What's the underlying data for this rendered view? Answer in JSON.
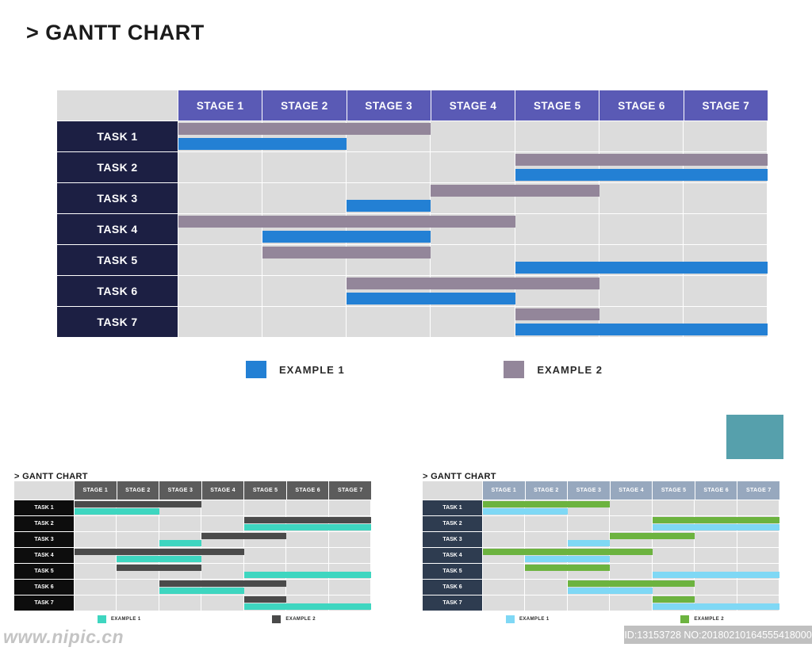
{
  "page": {
    "title": "> GANTT CHART"
  },
  "colors": {
    "header_purple": "#5a5ab5",
    "task_navy": "#1c1f43",
    "cell_gray": "#dcdcdc",
    "series1_blue": "#2380d4",
    "series2_mauve": "#93869a",
    "teal_block": "#56a0ac",
    "thumb_left_header": "#5c5c5c",
    "thumb_left_task": "#0d0d0d",
    "thumb_left_series1": "#3ed6c0",
    "thumb_left_series2": "#4a4a4a",
    "thumb_right_header": "#97a8be",
    "thumb_right_task": "#2e3c50",
    "thumb_right_series1": "#7fd8f5",
    "thumb_right_series2": "#6cb33f"
  },
  "chart_data": {
    "type": "bar",
    "title": "> GANTT CHART",
    "xlabel": "",
    "ylabel": "",
    "grid": true,
    "legend_position": "bottom",
    "categories": [
      "STAGE 1",
      "STAGE 2",
      "STAGE 3",
      "STAGE 4",
      "STAGE 5",
      "STAGE 6",
      "STAGE 7"
    ],
    "tasks": [
      "TASK 1",
      "TASK 2",
      "TASK 3",
      "TASK 4",
      "TASK 5",
      "TASK 6",
      "TASK 7"
    ],
    "legend": [
      {
        "label": "EXAMPLE 1",
        "color": "#2380d4"
      },
      {
        "label": "EXAMPLE 2",
        "color": "#93869a"
      }
    ],
    "series": [
      {
        "name": "EXAMPLE 2",
        "color": "#93869a",
        "row": "top",
        "bars": [
          {
            "task": "TASK 1",
            "start": 0,
            "end": 3
          },
          {
            "task": "TASK 2",
            "start": 4,
            "end": 7
          },
          {
            "task": "TASK 3",
            "start": 3,
            "end": 5
          },
          {
            "task": "TASK 4",
            "start": 0,
            "end": 4
          },
          {
            "task": "TASK 5",
            "start": 1,
            "end": 3
          },
          {
            "task": "TASK 6",
            "start": 2,
            "end": 5
          },
          {
            "task": "TASK 7",
            "start": 4,
            "end": 5
          }
        ]
      },
      {
        "name": "EXAMPLE 1",
        "color": "#2380d4",
        "row": "bottom",
        "bars": [
          {
            "task": "TASK 1",
            "start": 0,
            "end": 2
          },
          {
            "task": "TASK 2",
            "start": 4,
            "end": 7
          },
          {
            "task": "TASK 3",
            "start": 2,
            "end": 3
          },
          {
            "task": "TASK 4",
            "start": 1,
            "end": 3
          },
          {
            "task": "TASK 5",
            "start": 4,
            "end": 7
          },
          {
            "task": "TASK 6",
            "start": 2,
            "end": 4
          },
          {
            "task": "TASK 7",
            "start": 4,
            "end": 7
          }
        ]
      }
    ]
  },
  "thumbnails": [
    {
      "id": "thumb-left",
      "title": "> GANTT CHART",
      "header_bg": "#5c5c5c",
      "task_bg": "#0d0d0d",
      "legend": [
        {
          "label": "EXAMPLE 1",
          "color": "#3ed6c0"
        },
        {
          "label": "EXAMPLE 2",
          "color": "#4a4a4a"
        }
      ],
      "categories": [
        "STAGE 1",
        "STAGE 2",
        "STAGE 3",
        "STAGE 4",
        "STAGE 5",
        "STAGE 6",
        "STAGE 7"
      ],
      "tasks": [
        "TASK 1",
        "TASK 2",
        "TASK 3",
        "TASK 4",
        "TASK 5",
        "TASK 6",
        "TASK 7"
      ],
      "series": [
        {
          "name": "EXAMPLE 2",
          "color": "#4a4a4a",
          "row": "top",
          "bars": [
            {
              "task": "TASK 1",
              "start": 0,
              "end": 3
            },
            {
              "task": "TASK 2",
              "start": 4,
              "end": 7
            },
            {
              "task": "TASK 3",
              "start": 3,
              "end": 5
            },
            {
              "task": "TASK 4",
              "start": 0,
              "end": 4
            },
            {
              "task": "TASK 5",
              "start": 1,
              "end": 3
            },
            {
              "task": "TASK 6",
              "start": 2,
              "end": 5
            },
            {
              "task": "TASK 7",
              "start": 4,
              "end": 5
            }
          ]
        },
        {
          "name": "EXAMPLE 1",
          "color": "#3ed6c0",
          "row": "bottom",
          "bars": [
            {
              "task": "TASK 1",
              "start": 0,
              "end": 2
            },
            {
              "task": "TASK 2",
              "start": 4,
              "end": 7
            },
            {
              "task": "TASK 3",
              "start": 2,
              "end": 3
            },
            {
              "task": "TASK 4",
              "start": 1,
              "end": 3
            },
            {
              "task": "TASK 5",
              "start": 4,
              "end": 7
            },
            {
              "task": "TASK 6",
              "start": 2,
              "end": 4
            },
            {
              "task": "TASK 7",
              "start": 4,
              "end": 7
            }
          ]
        }
      ]
    },
    {
      "id": "thumb-right",
      "title": "> GANTT CHART",
      "header_bg": "#97a8be",
      "task_bg": "#2e3c50",
      "legend": [
        {
          "label": "EXAMPLE 1",
          "color": "#7fd8f5"
        },
        {
          "label": "EXAMPLE 2",
          "color": "#6cb33f"
        }
      ],
      "categories": [
        "STAGE 1",
        "STAGE 2",
        "STAGE 3",
        "STAGE 4",
        "STAGE 5",
        "STAGE 6",
        "STAGE 7"
      ],
      "tasks": [
        "TASK 1",
        "TASK 2",
        "TASK 3",
        "TASK 4",
        "TASK 5",
        "TASK 6",
        "TASK 7"
      ],
      "series": [
        {
          "name": "EXAMPLE 2",
          "color": "#6cb33f",
          "row": "top",
          "bars": [
            {
              "task": "TASK 1",
              "start": 0,
              "end": 3
            },
            {
              "task": "TASK 2",
              "start": 4,
              "end": 7
            },
            {
              "task": "TASK 3",
              "start": 3,
              "end": 5
            },
            {
              "task": "TASK 4",
              "start": 0,
              "end": 4
            },
            {
              "task": "TASK 5",
              "start": 1,
              "end": 3
            },
            {
              "task": "TASK 6",
              "start": 2,
              "end": 5
            },
            {
              "task": "TASK 7",
              "start": 4,
              "end": 5
            }
          ]
        },
        {
          "name": "EXAMPLE 1",
          "color": "#7fd8f5",
          "row": "bottom",
          "bars": [
            {
              "task": "TASK 1",
              "start": 0,
              "end": 2
            },
            {
              "task": "TASK 2",
              "start": 4,
              "end": 7
            },
            {
              "task": "TASK 3",
              "start": 2,
              "end": 3
            },
            {
              "task": "TASK 4",
              "start": 1,
              "end": 3
            },
            {
              "task": "TASK 5",
              "start": 4,
              "end": 7
            },
            {
              "task": "TASK 6",
              "start": 2,
              "end": 4
            },
            {
              "task": "TASK 7",
              "start": 4,
              "end": 7
            }
          ]
        }
      ]
    }
  ],
  "watermarks": {
    "site": "www.nipic.cn",
    "id_text": "ID:13153728 NO:20180210164555418000"
  }
}
